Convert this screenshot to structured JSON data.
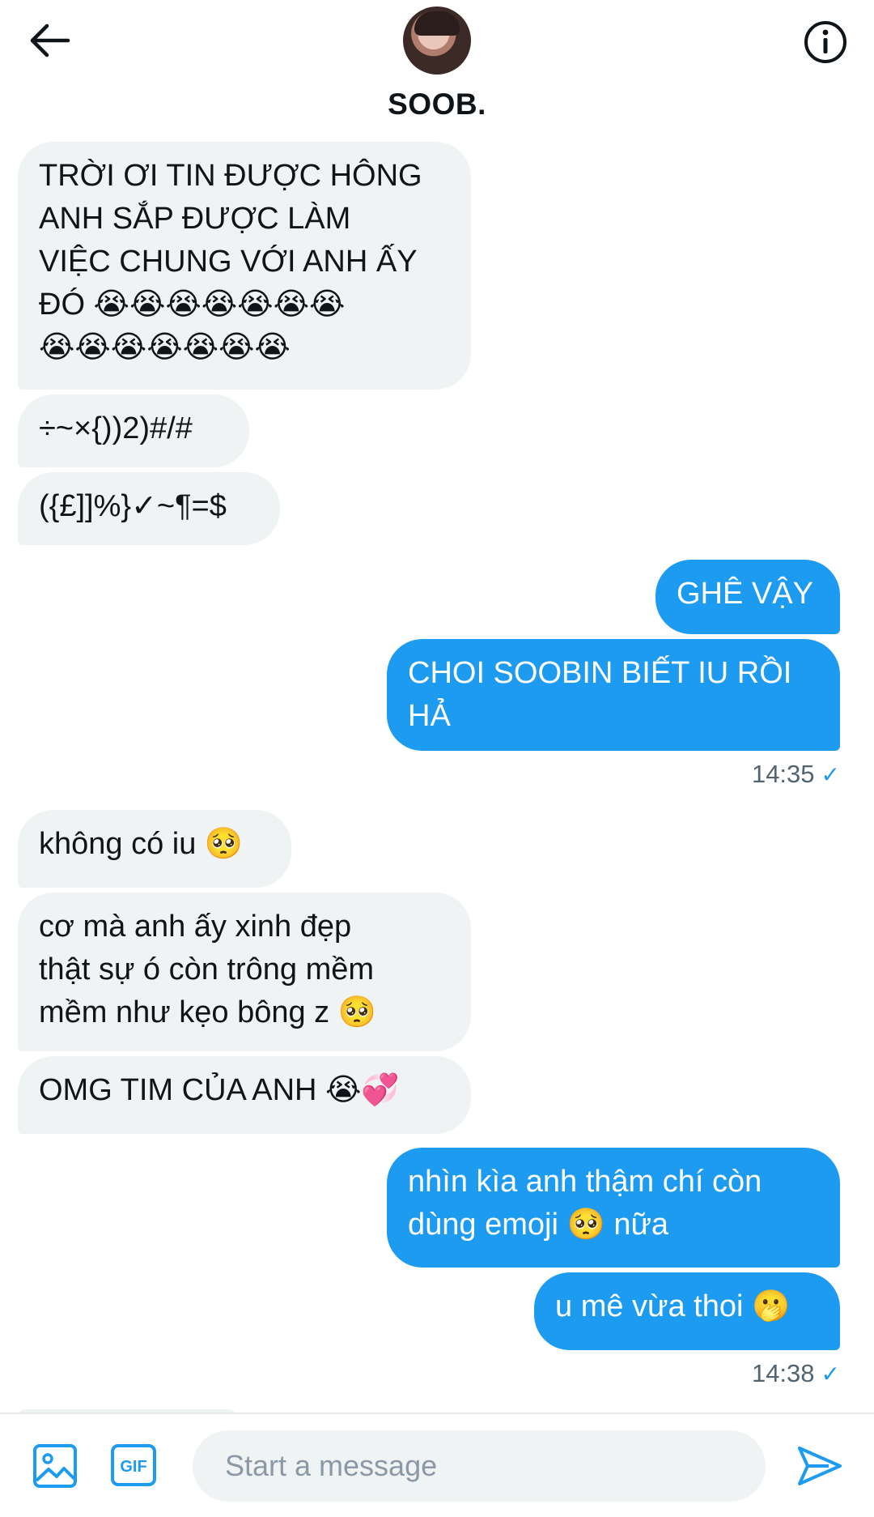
{
  "header": {
    "contact_name": "SOOB."
  },
  "messages": [
    {
      "dir": "in",
      "text": "TRỜI ƠI TIN ĐƯỢC HÔNG\nANH SẮP ĐƯỢC LÀM\nVIỆC CHUNG VỚI ANH ẤY\nĐÓ 😭😭😭😭😭😭😭\n😭😭😭😭😭😭😭"
    },
    {
      "dir": "in",
      "text": "÷~×{))2)#/#"
    },
    {
      "dir": "in",
      "text": "({£]]%}✓~¶=$"
    },
    {
      "dir": "out",
      "text": "GHÊ VẬY"
    },
    {
      "dir": "out",
      "text": "CHOI SOOBIN BIẾT IU RỒI\nHẢ"
    },
    {
      "dir": "in",
      "text": "không có iu 🥺"
    },
    {
      "dir": "in",
      "text": "cơ mà anh ấy xinh đẹp\nthật sự ó còn trông mềm\nmềm như kẹo bông z 🥺"
    },
    {
      "dir": "in",
      "text": "OMG TIM CỦA ANH 😭💞"
    },
    {
      "dir": "out",
      "text": "nhìn kìa anh thậm chí còn\ndùng emoji 🥺 nữa"
    },
    {
      "dir": "out",
      "text": "u mê vừa thoi 🫢"
    }
  ],
  "timestamps": {
    "first": "14:35",
    "second": "14:38",
    "check_glyph": "✓"
  },
  "composer": {
    "placeholder": "Start a message",
    "gif_label": "GIF"
  },
  "icons": [
    "back-arrow-icon",
    "info-icon",
    "image-icon",
    "gif-icon",
    "send-icon"
  ],
  "colors": {
    "accent": "#1d9bf0",
    "incoming_bubble": "#eff3f4"
  }
}
